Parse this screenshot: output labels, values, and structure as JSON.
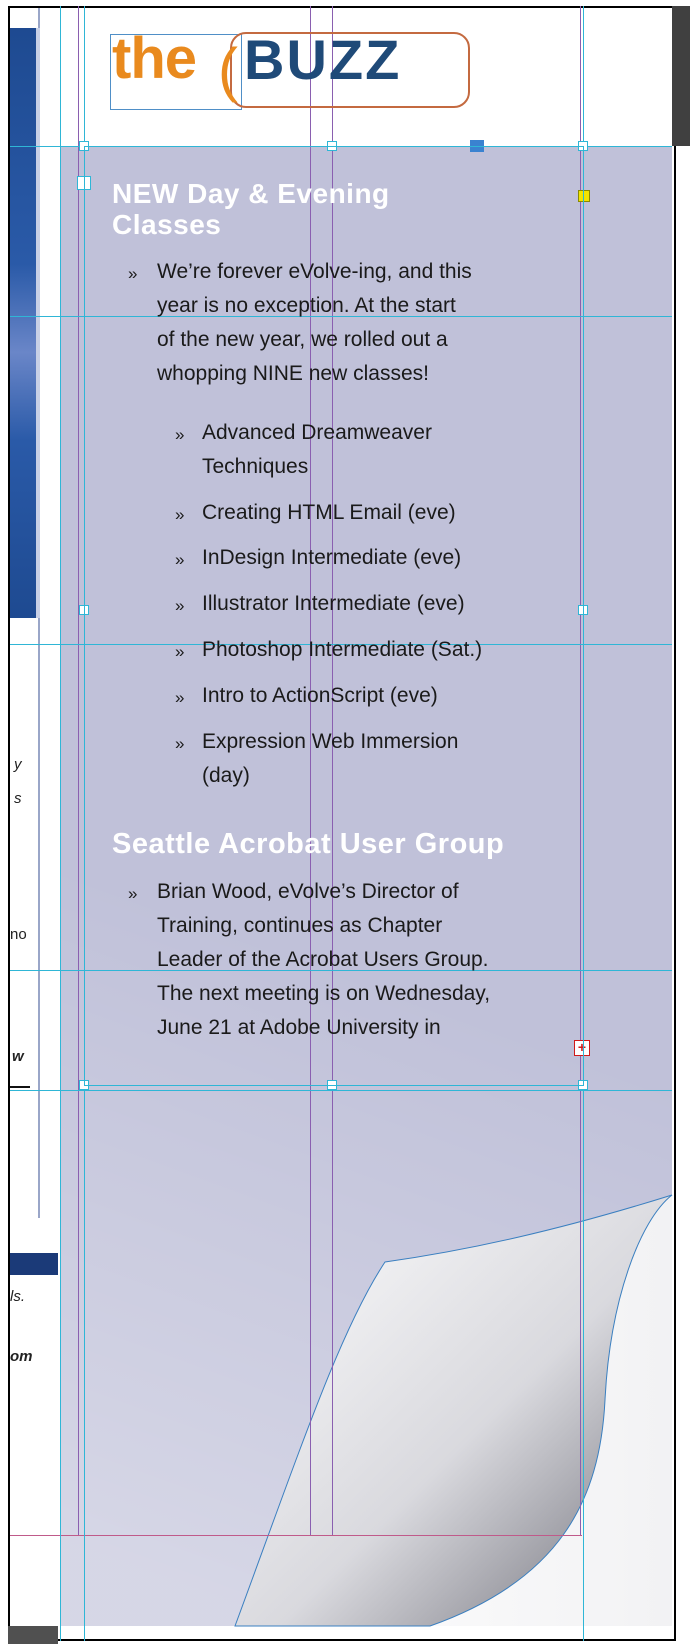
{
  "logo": {
    "the": "the",
    "buzz": "BUZZ",
    "bracket": "("
  },
  "colors": {
    "page_shade": "#c0c1d9",
    "guide_cyan": "#2fb6d6",
    "margin_purple": "#8a5fb0",
    "logo_orange": "#e98a1e",
    "logo_navy": "#1f4a78",
    "heading_white": "#ffffff",
    "overset_red": "#d01a1a"
  },
  "article": {
    "section1": {
      "heading_lines": [
        "NEW Day & Evening",
        "Classes"
      ],
      "bullet": "»",
      "intro_lines": [
        "We’re forever eVolve-ing, and this",
        "year is no exception. At the start",
        "of the new year, we rolled out a",
        "whopping NINE new classes!"
      ],
      "classes": [
        [
          "Advanced Dreamweaver",
          "Techniques"
        ],
        [
          "Creating HTML Email (eve)"
        ],
        [
          "InDesign Intermediate (eve)"
        ],
        [
          "Illustrator Intermediate (eve)"
        ],
        [
          "Photoshop Intermediate (Sat.)"
        ],
        [
          "Intro to ActionScript (eve)"
        ],
        [
          "Expression Web Immersion",
          "(day)"
        ]
      ]
    },
    "section2": {
      "heading": "Seattle Acrobat User Group",
      "bullet": "»",
      "lines": [
        "Brian Wood, eVolve’s Director of",
        "Training, continues as Chapter",
        "Leader of the Acrobat Users Group.",
        "The next meeting is on Wednesday,",
        "June 21 at Adobe University in"
      ]
    },
    "overset_marker": "+"
  },
  "left_page_fragments": {
    "f1": "y",
    "f2": "s",
    "f3": "no",
    "f4": "w",
    "f5": "ls.",
    "f6": "om"
  },
  "icons": {
    "overset": "overset-plus-icon",
    "curl": "page-curl-icon",
    "bullet": "guillemet-bullet"
  }
}
